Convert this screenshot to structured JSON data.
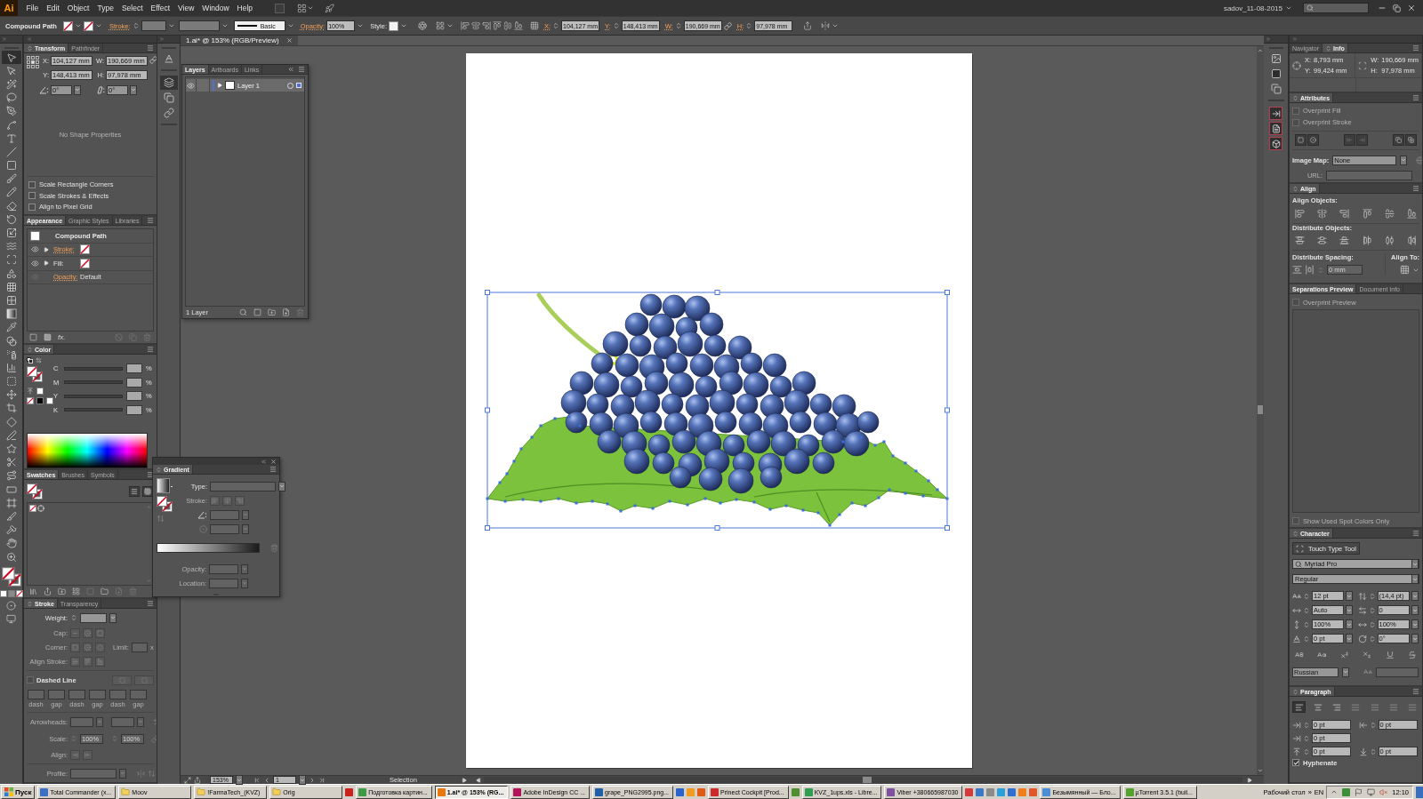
{
  "menu_bar": {
    "logo": "Ai",
    "menus": [
      "File",
      "Edit",
      "Object",
      "Type",
      "Select",
      "Effect",
      "View",
      "Window",
      "Help"
    ],
    "workspace": "sadov_11-08-2015"
  },
  "control_bar": {
    "object_type": "Compound Path",
    "stroke_label": "Stroke:",
    "profile": "Basic",
    "opacity_label": "Opacity:",
    "opacity": "100%",
    "style_label": "Style:",
    "position": [
      {
        "label": "X:",
        "value": "104,127 mm"
      },
      {
        "label": "Y:",
        "value": "148,413 mm"
      },
      {
        "label": "W:",
        "value": "190,669 mm"
      },
      {
        "label": "H:",
        "value": "97,978 mm"
      }
    ]
  },
  "tools": [
    {
      "kind": "selection",
      "selected": true
    },
    {
      "kind": "direct-selection",
      "selected": false
    },
    {
      "kind": "magic-wand",
      "selected": false
    },
    {
      "kind": "lasso",
      "selected": false
    },
    {
      "kind": "pen",
      "selected": false
    },
    {
      "kind": "curvature",
      "selected": false
    },
    {
      "kind": "type",
      "selected": false
    },
    {
      "kind": "line",
      "selected": false
    },
    {
      "kind": "rectangle",
      "selected": false
    },
    {
      "kind": "paintbrush",
      "selected": false
    },
    {
      "kind": "pencil",
      "selected": false
    },
    {
      "kind": "eraser",
      "selected": false
    },
    {
      "kind": "rotate",
      "selected": false
    },
    {
      "kind": "scale",
      "selected": false
    },
    {
      "kind": "warp",
      "selected": false
    },
    {
      "kind": "free-transform",
      "selected": false
    },
    {
      "kind": "shape-builder",
      "selected": false
    },
    {
      "kind": "perspective",
      "selected": false
    },
    {
      "kind": "mesh",
      "selected": false
    },
    {
      "kind": "gradient",
      "selected": false
    },
    {
      "kind": "eyedropper",
      "selected": false
    },
    {
      "kind": "blend",
      "selected": false
    },
    {
      "kind": "sprayer",
      "selected": false
    },
    {
      "kind": "graph",
      "selected": false
    },
    {
      "kind": "dotted-select",
      "selected": false
    },
    {
      "kind": "move",
      "selected": false
    },
    {
      "kind": "crop",
      "selected": false
    },
    {
      "kind": "skew",
      "selected": false
    },
    {
      "kind": "shaper",
      "selected": false
    },
    {
      "kind": "star",
      "selected": false
    },
    {
      "kind": "scissors",
      "selected": false
    },
    {
      "kind": "reshape",
      "selected": false
    },
    {
      "kind": "print-tiling",
      "selected": false
    },
    {
      "kind": "artboard",
      "selected": false
    },
    {
      "kind": "slice",
      "selected": false
    },
    {
      "kind": "knife",
      "selected": false
    },
    {
      "kind": "hand",
      "selected": false
    },
    {
      "kind": "zoom",
      "selected": false
    }
  ],
  "transform_panel": {
    "tabs": [
      {
        "label": "Transform",
        "selected": true
      },
      {
        "label": "Pathfinder",
        "selected": false
      }
    ],
    "fields": [
      {
        "label": "X:",
        "value": "104,127 mm"
      },
      {
        "label": "W:",
        "value": "190,669 mm"
      },
      {
        "label": "Y:",
        "value": "148,413 mm"
      },
      {
        "label": "H:",
        "value": "97,978 mm"
      }
    ],
    "rotate": "0°",
    "shear": "0°",
    "message": "No Shape Properties",
    "options": [
      {
        "label": "Scale Rectangle Corners",
        "checked": false
      },
      {
        "label": "Scale Strokes & Effects",
        "checked": false
      },
      {
        "label": "Align to Pixel Grid",
        "checked": false
      }
    ]
  },
  "appearance_panel": {
    "tabs": [
      {
        "label": "Appearance",
        "selected": true
      },
      {
        "label": "Graphic Styles",
        "selected": false
      },
      {
        "label": "Libraries",
        "selected": false
      }
    ],
    "rows": [
      {
        "kind": "object",
        "label": "Compound Path"
      },
      {
        "kind": "swatch",
        "label": "Stroke:",
        "link": true
      },
      {
        "kind": "swatch",
        "label": "Fill:",
        "link": false
      },
      {
        "kind": "value",
        "label": "Opacity:",
        "value": "Default",
        "link": true
      }
    ],
    "effects_button": "fx."
  },
  "color_panel": {
    "tabs": [
      {
        "label": "Color",
        "selected": true
      }
    ],
    "channels": [
      {
        "label": "C",
        "unit": "%"
      },
      {
        "label": "M",
        "unit": "%"
      },
      {
        "label": "Y",
        "unit": "%"
      },
      {
        "label": "K",
        "unit": "%"
      }
    ]
  },
  "swatches_panel": {
    "tabs": [
      {
        "label": "Swatches",
        "selected": true
      },
      {
        "label": "Brushes",
        "selected": false
      },
      {
        "label": "Symbols",
        "selected": false
      }
    ]
  },
  "stroke_panel": {
    "tabs": [
      {
        "label": "Stroke",
        "selected": true
      },
      {
        "label": "Transparency",
        "selected": false
      }
    ],
    "weight": "Weight:",
    "cap": "Cap:",
    "corner": "Corner:",
    "limit": "Limit:",
    "limit_unit": "x",
    "align_stroke": "Align Stroke:",
    "dashed_line": {
      "label": "Dashed Line",
      "checked": false
    },
    "dash_labels": [
      "dash",
      "gap",
      "dash",
      "gap",
      "dash",
      "gap"
    ],
    "arrowheads": "Arrowheads:",
    "scale": {
      "label": "Scale:",
      "start": "100%",
      "end": "100%"
    },
    "align": "Align:",
    "profile": "Profile:"
  },
  "dock": [
    {
      "kind": "character-styles",
      "selected": false
    },
    {
      "kind": "layers",
      "selected": true
    },
    {
      "kind": "artboards",
      "selected": false
    },
    {
      "kind": "links",
      "selected": false
    }
  ],
  "document": {
    "tabs": [
      {
        "title": "1.ai* @ 153% (RGB/Preview)",
        "selected": true
      }
    ],
    "zoom": "153%",
    "page": "1",
    "status": "Selection"
  },
  "layers_panel": {
    "tabs": [
      {
        "label": "Layers",
        "selected": true
      },
      {
        "label": "Artboards",
        "selected": false
      },
      {
        "label": "Links",
        "selected": false
      }
    ],
    "layers": [
      {
        "name": "Layer 1",
        "visible": true,
        "selected": true,
        "color": "#4f6fd8"
      }
    ],
    "footer": "1 Layer"
  },
  "gradient_panel": {
    "tabs": [
      {
        "label": "Gradient",
        "selected": true
      }
    ],
    "type_label": "Type:",
    "stroke_label": "Stroke:",
    "opacity_label": "Opacity:",
    "location_label": "Location:"
  },
  "info_panel": {
    "tabs": [
      {
        "label": "Navigator",
        "selected": false
      },
      {
        "label": "Info",
        "selected": true
      }
    ],
    "position": [
      {
        "label": "X:",
        "value": "8,793 mm"
      },
      {
        "label": "Y:",
        "value": "99,424 mm"
      }
    ],
    "size": [
      {
        "label": "W:",
        "value": "190,669 mm"
      },
      {
        "label": "H:",
        "value": "97,978 mm"
      }
    ]
  },
  "attributes_panel": {
    "tabs": [
      {
        "label": "Attributes",
        "selected": true
      }
    ],
    "options": [
      {
        "label": "Overprint Fill",
        "checked": false
      },
      {
        "label": "Overprint Stroke",
        "checked": false
      }
    ],
    "image_map_label": "Image Map:",
    "image_map": "None",
    "url_label": "URL:"
  },
  "align_panel": {
    "tabs": [
      {
        "label": "Align",
        "selected": true
      }
    ],
    "align_objects": "Align Objects:",
    "distribute_objects": "Distribute Objects:",
    "distribute_spacing": "Distribute Spacing:",
    "spacing": "0 mm",
    "align_to": "Align To:"
  },
  "separations_panel": {
    "tabs": [
      {
        "label": "Separations Preview",
        "selected": true
      },
      {
        "label": "Document Info",
        "selected": false
      }
    ],
    "overprint_preview": {
      "label": "Overprint Preview",
      "checked": false
    },
    "spot_only": {
      "label": "Show Used Spot Colors Only",
      "checked": false
    }
  },
  "character_panel": {
    "tabs": [
      {
        "label": "Character",
        "selected": true
      }
    ],
    "touch_type": "Touch Type Tool",
    "font": "Myriad Pro",
    "style": "Regular",
    "fields": [
      {
        "kind": "size",
        "value": "12 pt"
      },
      {
        "kind": "leading",
        "value": "(14,4 pt)"
      },
      {
        "kind": "kerning",
        "value": "Auto"
      },
      {
        "kind": "tracking",
        "value": "0"
      },
      {
        "kind": "vertical-scale",
        "value": "100%"
      },
      {
        "kind": "horizontal-scale",
        "value": "100%"
      },
      {
        "kind": "baseline",
        "value": "0 pt"
      },
      {
        "kind": "rotation",
        "value": "0°"
      }
    ],
    "language": "Russian"
  },
  "paragraph_panel": {
    "tabs": [
      {
        "label": "Paragraph",
        "selected": true
      }
    ],
    "alignment": [
      {
        "kind": "left",
        "selected": true
      },
      {
        "kind": "center",
        "selected": false
      },
      {
        "kind": "right",
        "selected": false
      },
      {
        "kind": "justify-left",
        "selected": false
      },
      {
        "kind": "justify-center",
        "selected": false
      },
      {
        "kind": "justify-right",
        "selected": false
      },
      {
        "kind": "justify-all",
        "selected": false
      }
    ],
    "indents": [
      {
        "kind": "left",
        "value": "0 pt"
      },
      {
        "kind": "right",
        "value": "0 pt"
      },
      {
        "kind": "first-line",
        "value": "0 pt"
      },
      {
        "kind": "space-before",
        "value": "0 pt"
      },
      {
        "kind": "space-after",
        "value": "0 pt"
      }
    ],
    "hyphenate": {
      "label": "Hyphenate",
      "checked": true
    }
  },
  "taskbar": {
    "start": "Пуск",
    "items": [
      {
        "kind": "app",
        "label": "Total Commander (x...",
        "color": "#3b6fc4",
        "selected": false
      },
      {
        "kind": "folder",
        "label": "Moov",
        "selected": false
      },
      {
        "kind": "folder",
        "label": "!FarmaTech_(KVZ)",
        "selected": false
      },
      {
        "kind": "folder",
        "label": "Orig",
        "selected": false
      },
      {
        "kind": "icon",
        "color": "#c8241c"
      },
      {
        "kind": "app",
        "label": "Подготовка картин...",
        "color": "#3e9b45",
        "selected": false
      },
      {
        "kind": "app",
        "label": "1.ai* @ 153% (RG...",
        "color": "#e8780c",
        "selected": true
      },
      {
        "kind": "app",
        "label": "Adobe InDesign CC ...",
        "color": "#b3135a",
        "selected": false
      },
      {
        "kind": "app",
        "label": "grape_PNG2995.png...",
        "color": "#1f5fa8",
        "selected": false
      },
      {
        "kind": "icon",
        "color": "#2a63c9"
      },
      {
        "kind": "icon",
        "color": "#f39a1e"
      },
      {
        "kind": "icon",
        "color": "#e05a12"
      },
      {
        "kind": "app",
        "label": "Prinect Cockpit [Prod...",
        "color": "#cc2a2a",
        "selected": false
      },
      {
        "kind": "icon",
        "color": "#4f8f2f"
      },
      {
        "kind": "app",
        "label": "KVZ_1ups.xls - Libre...",
        "color": "#2f9e4f",
        "selected": false
      },
      {
        "kind": "app",
        "label": "Viber +380665987030",
        "color": "#7d51a0",
        "selected": false
      },
      {
        "kind": "icon",
        "color": "#d23b3b"
      },
      {
        "kind": "icon",
        "color": "#3a78c8"
      },
      {
        "kind": "icon",
        "color": "#8a8a8a"
      },
      {
        "kind": "icon",
        "color": "#2a9fd8"
      },
      {
        "kind": "icon",
        "color": "#2f6fd0"
      },
      {
        "kind": "icon",
        "color": "#f07f1a"
      },
      {
        "kind": "icon",
        "color": "#e3562a"
      },
      {
        "kind": "app",
        "label": "Безымянный — Бло...",
        "color": "#4a8fd6",
        "selected": false
      },
      {
        "kind": "app",
        "label": "µTorrent 3.5.1 (buil...",
        "color": "#53a22d",
        "selected": false
      }
    ],
    "desktop": "Рабочий стол",
    "chevron": "»",
    "language": "EN",
    "clock": "12:10"
  }
}
